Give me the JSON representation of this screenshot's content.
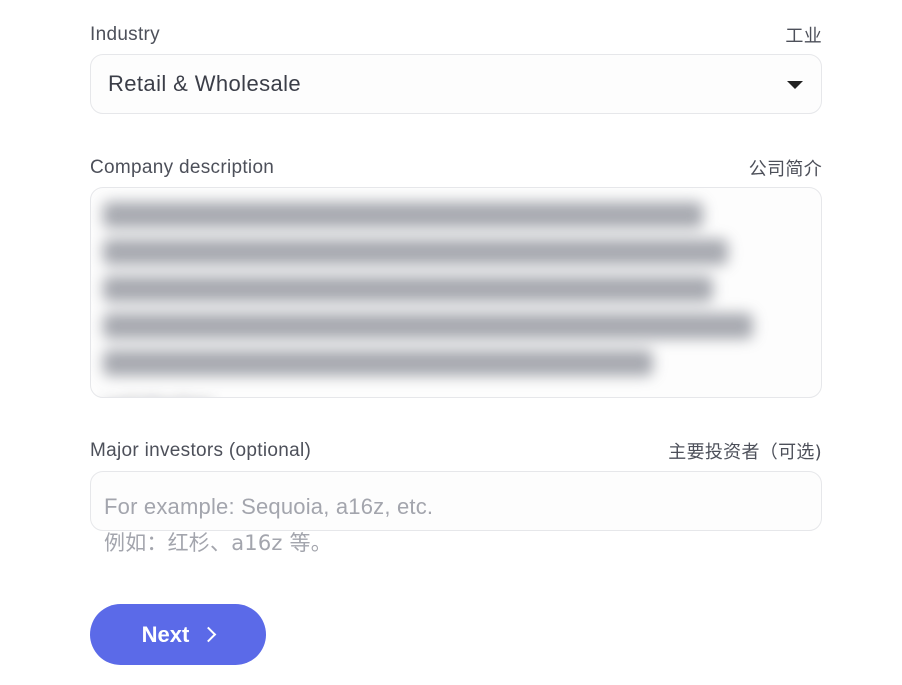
{
  "industry": {
    "label": "Industry",
    "label_cn": "工业",
    "selected_value": "Retail & Wholesale"
  },
  "description": {
    "label": "Company description",
    "label_cn": "公司简介",
    "partial_visible_text": "satisfaction"
  },
  "investors": {
    "label": "Major investors (optional)",
    "label_cn": "主要投资者（可选)",
    "placeholder_en": "For example: Sequoia, a16z, etc.",
    "placeholder_cn": "例如：红杉、a16z 等。"
  },
  "actions": {
    "next_label": "Next"
  },
  "colors": {
    "primary": "#5b6ae8",
    "field_border": "#e6e7ea",
    "placeholder": "#a3a5ad"
  }
}
